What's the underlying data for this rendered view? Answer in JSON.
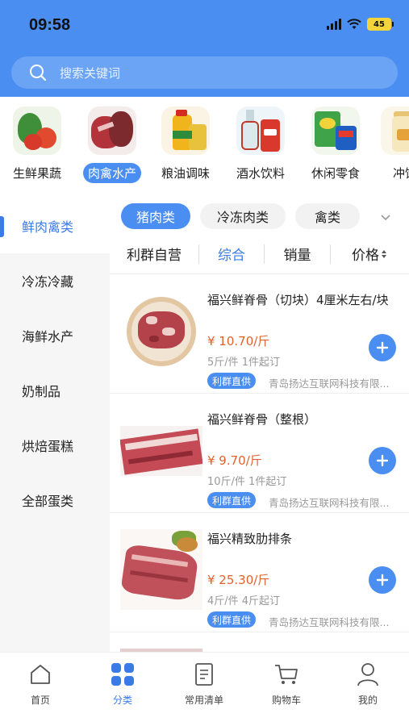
{
  "status_bar": {
    "time": "09:58",
    "battery": "45"
  },
  "search": {
    "placeholder": "搜索关键词"
  },
  "categories": [
    {
      "label": "生鲜果蔬",
      "icon": "vegetables-icon",
      "active": false
    },
    {
      "label": "肉禽水产",
      "icon": "meat-icon",
      "active": true
    },
    {
      "label": "粮油调味",
      "icon": "oil-icon",
      "active": false
    },
    {
      "label": "酒水饮料",
      "icon": "drinks-icon",
      "active": false
    },
    {
      "label": "休闲零食",
      "icon": "snacks-icon",
      "active": false
    },
    {
      "label": "冲饮",
      "icon": "beverage-icon",
      "active": false
    }
  ],
  "side_nav": [
    {
      "label": "鲜肉禽类",
      "active": true
    },
    {
      "label": "冷冻冷藏",
      "active": false
    },
    {
      "label": "海鲜水产",
      "active": false
    },
    {
      "label": "奶制品",
      "active": false
    },
    {
      "label": "烘焙蛋糕",
      "active": false
    },
    {
      "label": "全部蛋类",
      "active": false
    }
  ],
  "sub_tabs": [
    {
      "label": "猪肉类",
      "active": true
    },
    {
      "label": "冷冻肉类",
      "active": false
    },
    {
      "label": "禽类",
      "active": false
    }
  ],
  "sort_bar": {
    "self_operated": "利群自营",
    "comprehensive": "综合",
    "sales": "销量",
    "price": "价格"
  },
  "products": [
    {
      "name": "福兴鲜脊骨（切块）4厘米左右/块",
      "price": "¥ 10.70/斤",
      "spec": "5斤/件  1件起订",
      "tag": "利群直供",
      "supplier": "青岛扬达互联网科技有限..."
    },
    {
      "name": "福兴鲜脊骨（整根）",
      "price": "¥ 9.70/斤",
      "spec": "10斤/件  1件起订",
      "tag": "利群直供",
      "supplier": "青岛扬达互联网科技有限..."
    },
    {
      "name": "福兴精致肋排条",
      "price": "¥ 25.30/斤",
      "spec": "4斤/件  4斤起订",
      "tag": "利群直供",
      "supplier": "青岛扬达互联网科技有限..."
    }
  ],
  "tab_bar": [
    {
      "label": "首页",
      "icon": "home-icon",
      "active": false
    },
    {
      "label": "分类",
      "icon": "category-grid-icon",
      "active": true
    },
    {
      "label": "常用清单",
      "icon": "list-icon",
      "active": false
    },
    {
      "label": "购物车",
      "icon": "cart-icon",
      "active": false
    },
    {
      "label": "我的",
      "icon": "user-icon",
      "active": false
    }
  ],
  "colors": {
    "brand": "#4b8ef1",
    "price": "#e0622b",
    "active_text": "#3a7be6"
  }
}
